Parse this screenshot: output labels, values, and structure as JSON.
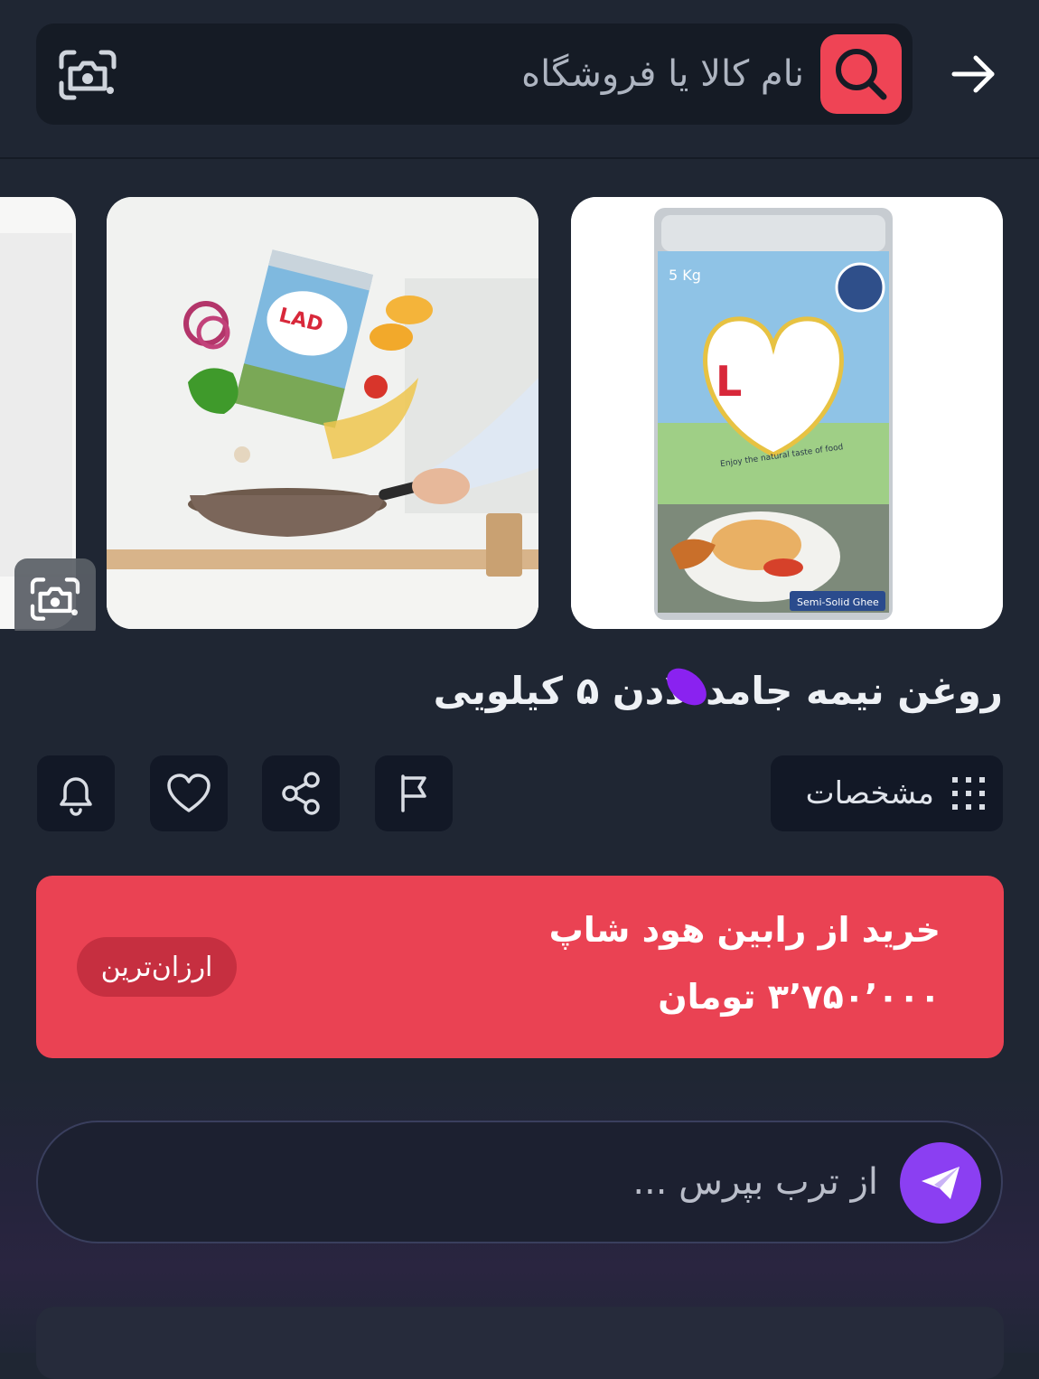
{
  "search": {
    "placeholder": "نام کالا یا فروشگاه"
  },
  "product": {
    "title": "روغن نیمه جامد لادن ۵ کیلویی"
  },
  "actions": {
    "specs_label": "مشخصات"
  },
  "buy": {
    "title": "خرید از رابین هود شاپ",
    "price": "۳٬۷۵۰٬۰۰۰ تومان",
    "badge": "ارزان‌ترین"
  },
  "ask": {
    "placeholder": "از ترب بپرس ..."
  },
  "images": {
    "product_can_label_weight": "5 Kg",
    "product_can_label_type": "Semi-Solid Ghee",
    "product_can_tagline": "Enjoy the natural taste of food"
  },
  "colors": {
    "background": "#1f2633",
    "accent_red": "#ea4253",
    "accent_purple": "#8b3ff2",
    "button_dark": "#121826"
  }
}
